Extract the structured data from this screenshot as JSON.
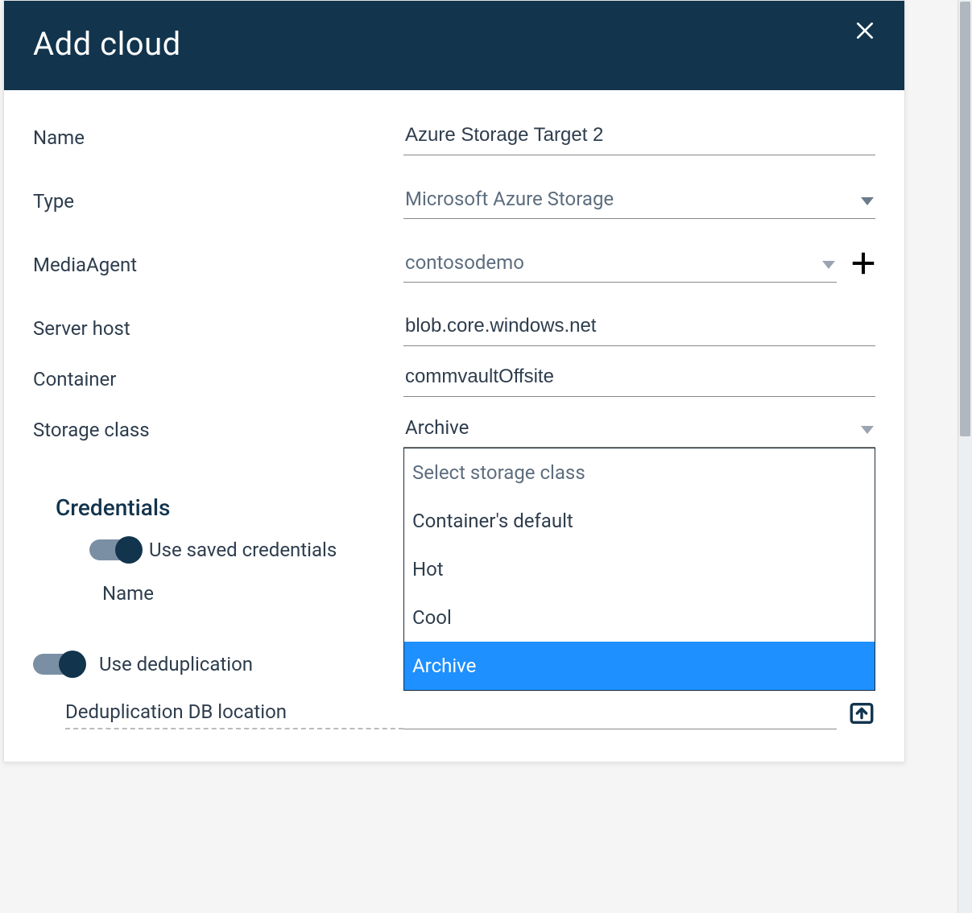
{
  "dialog": {
    "title": "Add cloud"
  },
  "fields": {
    "name_label": "Name",
    "name_value": "Azure Storage Target 2",
    "type_label": "Type",
    "type_value": "Microsoft Azure Storage",
    "mediaagent_label": "MediaAgent",
    "mediaagent_value": "contosodemo",
    "serverhost_label": "Server host",
    "serverhost_value": "blob.core.windows.net",
    "container_label": "Container",
    "container_value": "commvaultOffsite",
    "storageclass_label": "Storage class",
    "storageclass_value": "Archive"
  },
  "storage_class_options": {
    "placeholder": "Select storage class",
    "o1": "Container's default",
    "o2": "Hot",
    "o3": "Cool",
    "o4": "Archive"
  },
  "credentials": {
    "heading": "Credentials",
    "use_saved_label": "Use saved credentials",
    "name_label": "Name"
  },
  "dedup": {
    "toggle_label": "Use deduplication",
    "db_location_label": "Deduplication DB location"
  }
}
